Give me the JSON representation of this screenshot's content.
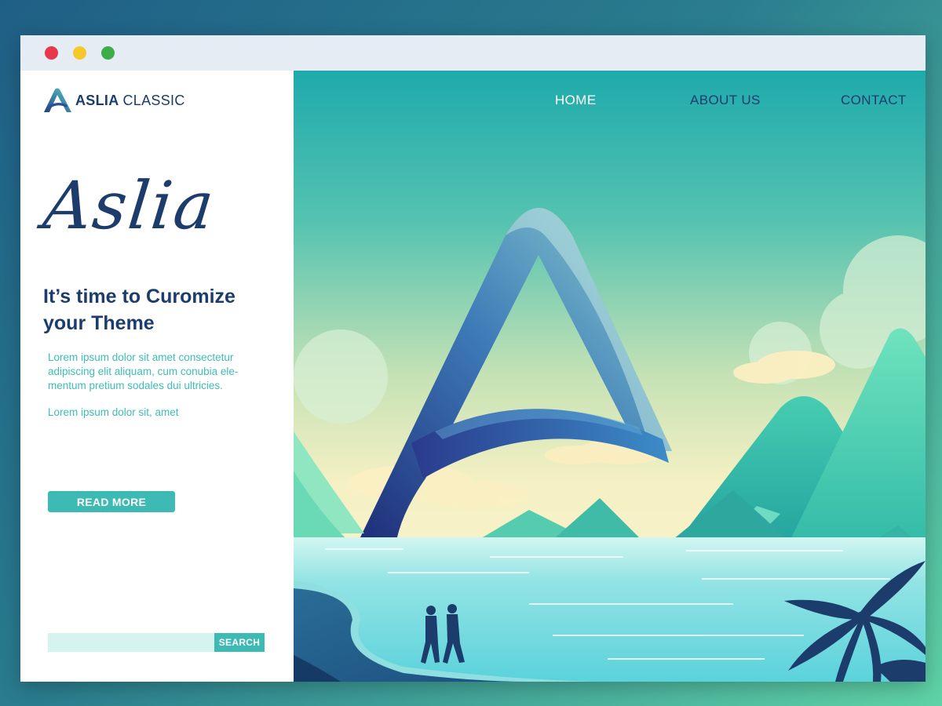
{
  "brand": {
    "name_bold": "ASLIA",
    "name_light": "CLASSIC"
  },
  "hero_script_title": "Aslia",
  "headline": "It’s time to Curomize your Theme",
  "paragraphs": [
    "Lorem ipsum dolor sit amet consectetur adipiscing elit aliquam, cum conubia ele- mentum pretium sodales dui ultricies.",
    "Lorem ipsum dolor sit, amet"
  ],
  "read_more_label": "READ MORE",
  "search": {
    "placeholder": "",
    "button_label": "SEARCH"
  },
  "nav": {
    "home": "HOME",
    "about": "ABOUT US",
    "contact": "CONTACT"
  },
  "colors": {
    "navy": "#1c3c6c",
    "teal_accent": "#3dbab4",
    "search_field_bg": "#d6f4ef",
    "window_dot_red": "#e8364a",
    "window_dot_yellow": "#f6c82d",
    "window_dot_green": "#3cae45"
  },
  "icons": [
    "aslia-logo-icon",
    "palm-tree-icon",
    "walking-couple-icon"
  ]
}
